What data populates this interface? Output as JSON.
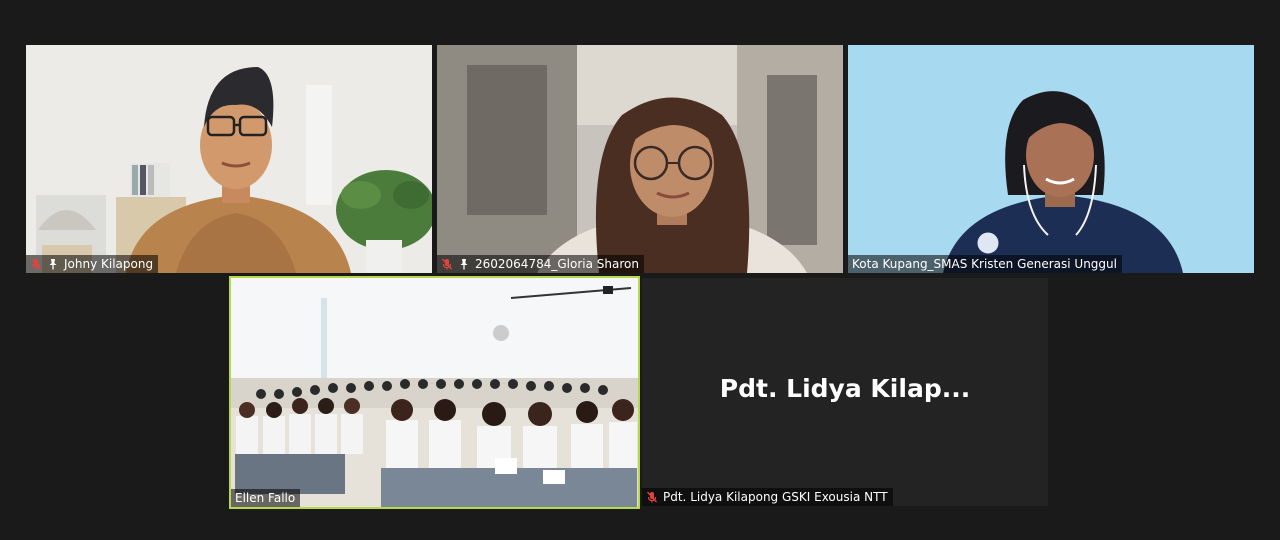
{
  "participants": [
    {
      "name": "Johny Kilapong",
      "muted": true,
      "pinned": true
    },
    {
      "name": "2602064784_Gloria Sharon",
      "muted": true,
      "pinned": true
    },
    {
      "name": "Kota Kupang_SMAS Kristen Generasi Unggul",
      "muted": false,
      "pinned": false
    },
    {
      "name": "Ellen Fallo",
      "muted": false,
      "pinned": false,
      "active_speaker": true
    },
    {
      "name": "Pdt. Lidya Kilapong GSKI Exousia NTT",
      "muted": true,
      "pinned": false,
      "video_off": true,
      "display_name": "Pdt. Lidya Kilap..."
    }
  ],
  "colors": {
    "background": "#1a1a1a",
    "active_speaker_border": "#b6d94a",
    "mute_icon": "#e0443e"
  },
  "icons": {
    "mute": "microphone-muted-icon",
    "pin": "pin-icon"
  }
}
